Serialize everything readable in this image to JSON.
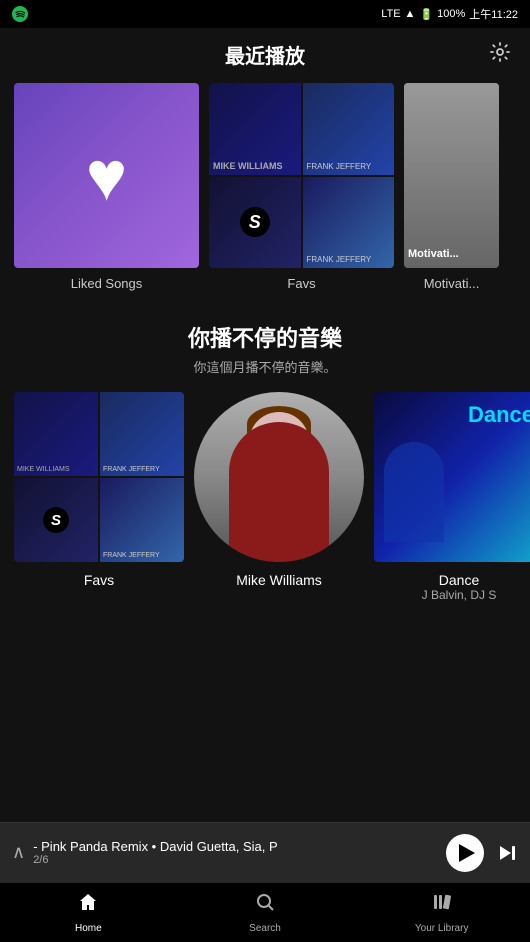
{
  "statusBar": {
    "carrier": "Spotify",
    "signal": "LTE",
    "battery": "100%",
    "time": "上午11:22"
  },
  "header": {
    "recentTitle": "最近播放"
  },
  "recentItems": [
    {
      "id": "liked",
      "label": "Liked Songs",
      "type": "liked"
    },
    {
      "id": "favs1",
      "label": "Favs",
      "type": "grid"
    },
    {
      "id": "motivation",
      "label": "Motivati...",
      "type": "motivation"
    }
  ],
  "section2": {
    "title": "你播不停的音樂",
    "subtitle": "你這個月播不停的音樂。",
    "items": [
      {
        "id": "favs2",
        "label": "Favs",
        "sub": "",
        "type": "grid"
      },
      {
        "id": "mike",
        "label": "Mike Williams",
        "sub": "",
        "type": "person"
      },
      {
        "id": "dance",
        "label": "Dance",
        "sub": "J Balvin, DJ S",
        "type": "dance"
      }
    ]
  },
  "player": {
    "trackName": "- Pink Panda Remix • David Guetta, Sia, P",
    "progress": "2/6"
  },
  "bottomNav": {
    "items": [
      {
        "id": "home",
        "label": "Home",
        "icon": "⌂",
        "active": true
      },
      {
        "id": "search",
        "label": "Search",
        "icon": "🔍",
        "active": false
      },
      {
        "id": "library",
        "label": "Your Library",
        "icon": "📚",
        "active": false
      }
    ]
  },
  "icons": {
    "settings": "⚙",
    "chevronUp": "∧",
    "play": "▶",
    "skip": "⏭"
  }
}
